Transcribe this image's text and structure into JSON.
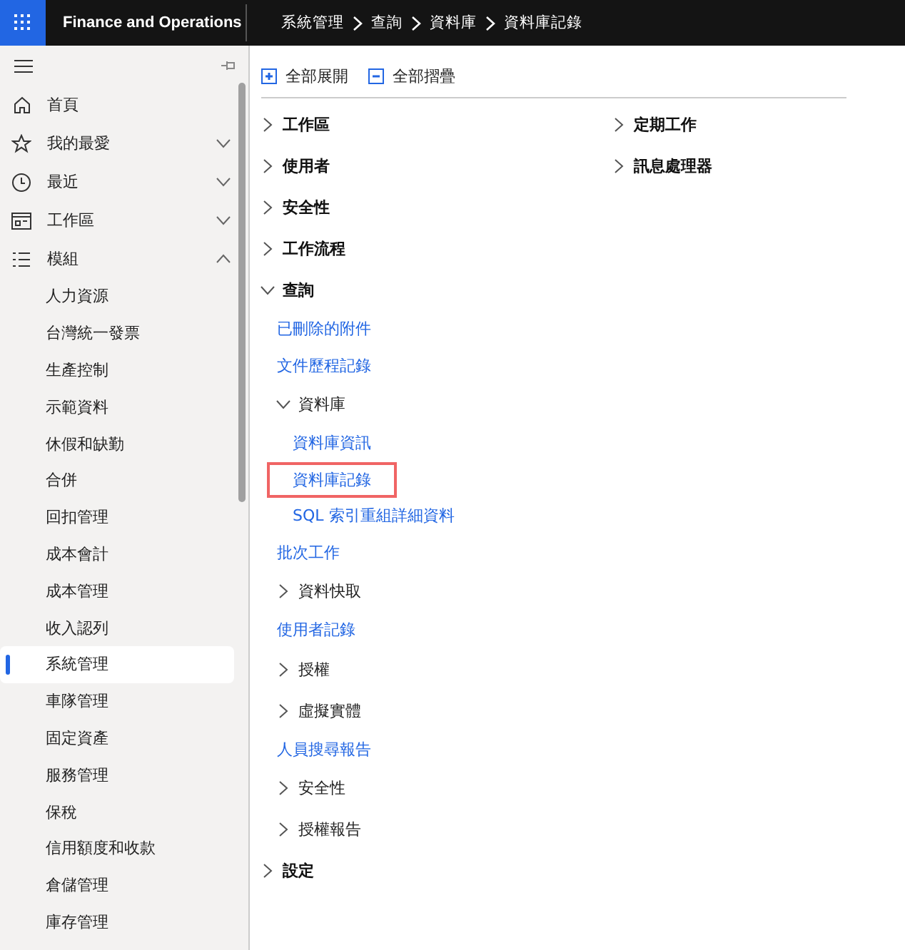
{
  "header": {
    "app_title": "Finance and Operations",
    "breadcrumb": [
      "系統管理",
      "查詢",
      "資料庫",
      "資料庫記錄"
    ]
  },
  "sidebar": {
    "nav": [
      {
        "label": "首頁"
      },
      {
        "label": "我的最愛",
        "expanded": false
      },
      {
        "label": "最近",
        "expanded": false
      },
      {
        "label": "工作區",
        "expanded": false
      },
      {
        "label": "模組",
        "expanded": true
      }
    ],
    "modules": [
      {
        "label": "人力資源",
        "selected": false
      },
      {
        "label": "台灣統一發票",
        "selected": false
      },
      {
        "label": "生產控制",
        "selected": false
      },
      {
        "label": "示範資料",
        "selected": false
      },
      {
        "label": "休假和缺勤",
        "selected": false
      },
      {
        "label": "合併",
        "selected": false
      },
      {
        "label": "回扣管理",
        "selected": false
      },
      {
        "label": "成本會計",
        "selected": false
      },
      {
        "label": "成本管理",
        "selected": false
      },
      {
        "label": "收入認列",
        "selected": false
      },
      {
        "label": "系統管理",
        "selected": true
      },
      {
        "label": "車隊管理",
        "selected": false
      },
      {
        "label": "固定資產",
        "selected": false
      },
      {
        "label": "服務管理",
        "selected": false
      },
      {
        "label": "保稅",
        "selected": false
      },
      {
        "label": "信用額度和收款",
        "selected": false
      },
      {
        "label": "倉儲管理",
        "selected": false
      },
      {
        "label": "庫存管理",
        "selected": false
      }
    ]
  },
  "toolbar": [
    {
      "label": "全部展開"
    },
    {
      "label": "全部摺疊"
    }
  ],
  "columns": [
    [
      {
        "kind": "group",
        "label": "工作區",
        "expanded": false
      },
      {
        "kind": "group",
        "label": "使用者",
        "expanded": false
      },
      {
        "kind": "group",
        "label": "安全性",
        "expanded": false
      },
      {
        "kind": "group",
        "label": "工作流程",
        "expanded": false
      },
      {
        "kind": "group",
        "label": "查詢",
        "expanded": true,
        "children": [
          {
            "kind": "link",
            "label": "已刪除的附件",
            "highlighted": false
          },
          {
            "kind": "link",
            "label": "文件歷程記錄",
            "highlighted": false
          },
          {
            "kind": "group",
            "label": "資料庫",
            "expanded": true,
            "children": [
              {
                "kind": "link",
                "label": "資料庫資訊",
                "highlighted": false
              },
              {
                "kind": "link",
                "label": "資料庫記錄",
                "highlighted": true
              },
              {
                "kind": "link",
                "label": "SQL 索引重組詳細資料",
                "highlighted": false
              }
            ]
          },
          {
            "kind": "link",
            "label": "批次工作",
            "highlighted": false
          },
          {
            "kind": "group",
            "label": "資料快取",
            "expanded": false
          },
          {
            "kind": "link",
            "label": "使用者記錄",
            "highlighted": false
          },
          {
            "kind": "group",
            "label": "授權",
            "expanded": false
          },
          {
            "kind": "group",
            "label": "虛擬實體",
            "expanded": false
          },
          {
            "kind": "link",
            "label": "人員搜尋報告",
            "highlighted": false
          },
          {
            "kind": "group",
            "label": "安全性",
            "expanded": false
          },
          {
            "kind": "group",
            "label": "授權報告",
            "expanded": false
          }
        ]
      },
      {
        "kind": "group",
        "label": "設定",
        "expanded": false
      }
    ],
    [
      {
        "kind": "group",
        "label": "定期工作",
        "expanded": false
      },
      {
        "kind": "group",
        "label": "訊息處理器",
        "expanded": false
      }
    ]
  ]
}
